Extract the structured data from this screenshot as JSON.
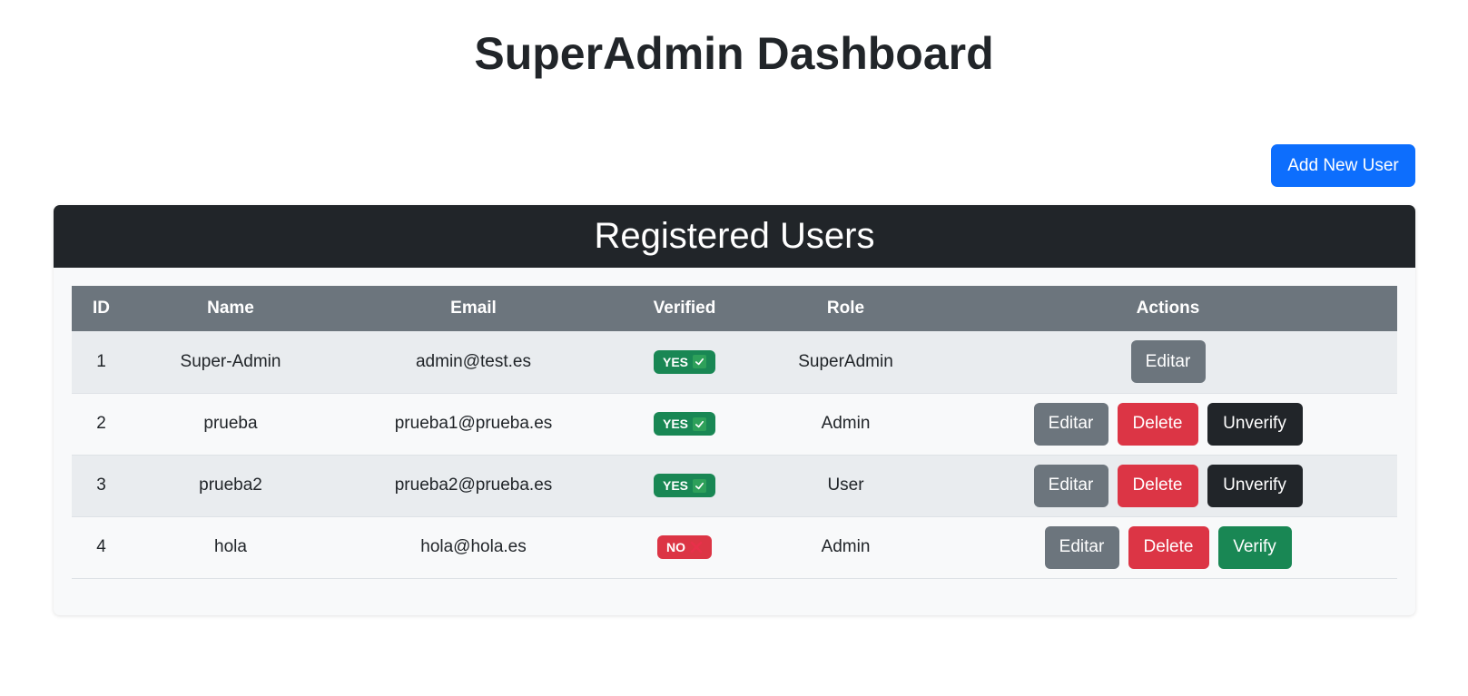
{
  "header": {
    "title": "SuperAdmin Dashboard"
  },
  "toolbar": {
    "add_user_label": "Add New User"
  },
  "card": {
    "title": "Registered Users"
  },
  "table": {
    "columns": [
      "ID",
      "Name",
      "Email",
      "Verified",
      "Role",
      "Actions"
    ],
    "rows": [
      {
        "id": "1",
        "name": "Super-Admin",
        "email": "admin@test.es",
        "verified": "YES",
        "is_verified": true,
        "role": "SuperAdmin",
        "actions": [
          "Editar"
        ]
      },
      {
        "id": "2",
        "name": "prueba",
        "email": "prueba1@prueba.es",
        "verified": "YES",
        "is_verified": true,
        "role": "Admin",
        "actions": [
          "Editar",
          "Delete",
          "Unverify"
        ]
      },
      {
        "id": "3",
        "name": "prueba2",
        "email": "prueba2@prueba.es",
        "verified": "YES",
        "is_verified": true,
        "role": "User",
        "actions": [
          "Editar",
          "Delete",
          "Unverify"
        ]
      },
      {
        "id": "4",
        "name": "hola",
        "email": "hola@hola.es",
        "verified": "NO",
        "is_verified": false,
        "role": "Admin",
        "actions": [
          "Editar",
          "Delete",
          "Verify"
        ]
      }
    ]
  },
  "colors": {
    "primary": "#0d6efd",
    "dark": "#212529",
    "secondary": "#6c757d",
    "danger": "#dc3545",
    "success": "#198754"
  },
  "icons": {
    "verified_yes": "check-icon",
    "verified_no": "x-icon"
  }
}
